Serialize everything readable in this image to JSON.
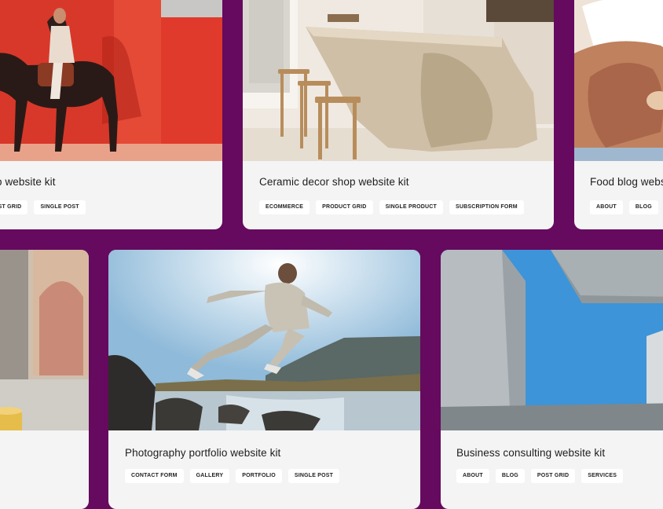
{
  "cards": [
    {
      "title": "o website kit",
      "tags": [
        "OST GRID",
        "SINGLE POST"
      ],
      "image": "rider-on-horse-red-wall-photo"
    },
    {
      "title": "Ceramic decor shop website kit",
      "tags": [
        "ECOMMERCE",
        "PRODUCT GRID",
        "SINGLE PRODUCT",
        "SUBSCRIPTION FORM"
      ],
      "image": "stone-kitchen-island-photo"
    },
    {
      "title": "Food blog webs",
      "tags": [
        "ABOUT",
        "BLOG",
        "P"
      ],
      "image": "hands-holding-food-photo"
    },
    {
      "title": "",
      "tags": [
        ""
      ],
      "image": "interior-arch-painting-photo"
    },
    {
      "title": "Photography portfolio website kit",
      "tags": [
        "CONTACT FORM",
        "GALLERY",
        "PORTFOLIO",
        "SINGLE POST"
      ],
      "image": "person-jumping-over-lake-photo"
    },
    {
      "title": "Business consulting website kit",
      "tags": [
        "ABOUT",
        "BLOG",
        "POST GRID",
        "SERVICES"
      ],
      "image": "concrete-architecture-sky-photo"
    }
  ],
  "colors": {
    "background": "#650a5e",
    "card": "#f4f4f4",
    "tag": "#ffffff"
  }
}
